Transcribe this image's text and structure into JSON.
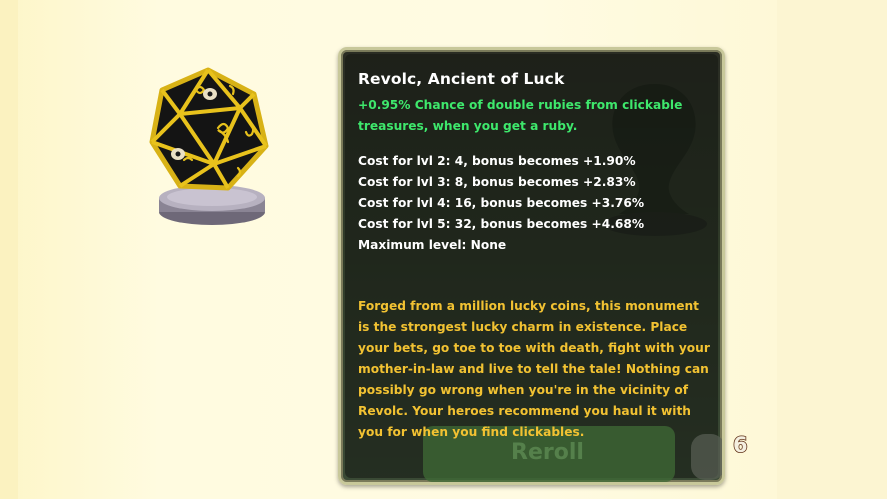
{
  "ancient": {
    "name": "Revolc, Ancient of Luck",
    "bonus_text": "+0.95% Chance of double rubies from clickable treasures, when you get a ruby.",
    "costs": [
      "Cost for lvl 2: 4, bonus becomes +1.90%",
      "Cost for lvl 3: 8, bonus becomes +2.83%",
      "Cost for lvl 4: 16, bonus becomes +3.76%",
      "Cost for lvl 5: 32, bonus becomes +4.68%",
      "Maximum level: None"
    ],
    "lore": "Forged from a million lucky coins, this monument is the strongest lucky charm in existence. Place your bets, go toe to toe with death, fight with your mother-in-law and live to tell the tale! Nothing can possibly go wrong when you're in the vicinity of Revolc. Your heroes recommend you haul it with you for when you find clickables."
  },
  "reroll": {
    "label": "Reroll"
  },
  "reroll_cost": "6",
  "icons": {
    "trophy": "d20-dice-trophy-icon",
    "ghost": "ancient-silhouette-icon",
    "gem": "gem-icon"
  },
  "colors": {
    "background": "#fdf8d6",
    "panel": "#2f3a28",
    "title": "#ffffff",
    "bonus": "#3ee86c",
    "lore": "#f2c232"
  }
}
